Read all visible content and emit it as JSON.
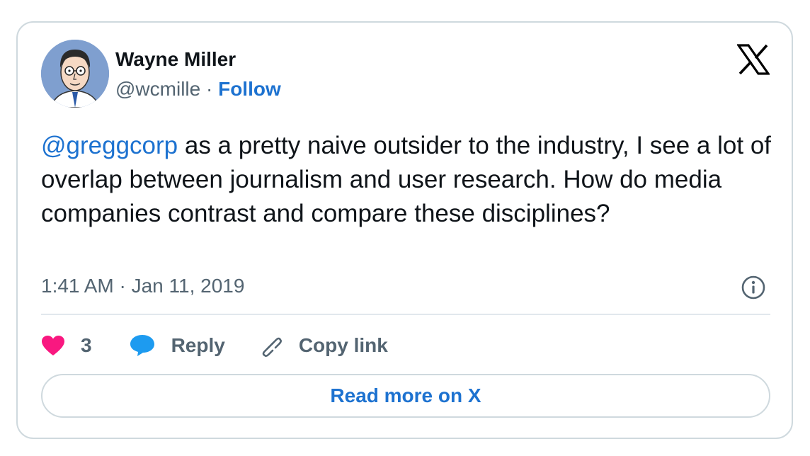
{
  "author": {
    "name": "Wayne Miller",
    "handle": "@wcmille",
    "separator": "·",
    "follow_label": "Follow"
  },
  "brand": {
    "logo_icon": "x-logo-icon"
  },
  "tweet": {
    "mention": "@greggcorp",
    "text": " as a pretty naive outsider to the industry, I see a lot of overlap between journalism and user research. How do media companies contrast and compare these disciplines?",
    "timestamp": "1:41 AM · Jan 11, 2019"
  },
  "actions": {
    "like_count": "3",
    "reply_label": "Reply",
    "copy_link_label": "Copy link"
  },
  "read_more_label": "Read more on X",
  "colors": {
    "link": "#1d72d0",
    "like": "#f91880",
    "reply": "#1d9bf0",
    "muted": "#536471",
    "text": "#0f1419",
    "border": "#cfd9de"
  }
}
